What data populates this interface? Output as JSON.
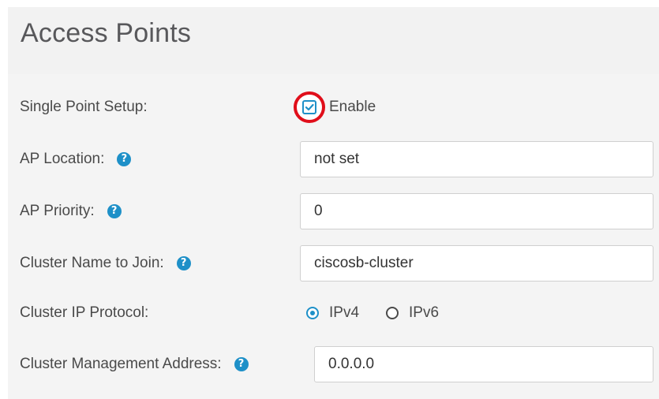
{
  "page": {
    "title": "Access Points"
  },
  "form": {
    "single_point_setup": {
      "label": "Single Point Setup:",
      "checkbox_label": "Enable",
      "checked": true
    },
    "ap_location": {
      "label": "AP Location:",
      "value": "not set",
      "help_icon": "question-circle-icon"
    },
    "ap_priority": {
      "label": "AP Priority:",
      "value": "0",
      "help_icon": "question-circle-icon"
    },
    "cluster_name": {
      "label": "Cluster Name to Join:",
      "value": "ciscosb-cluster",
      "help_icon": "question-circle-icon"
    },
    "cluster_ip_protocol": {
      "label": "Cluster IP Protocol:",
      "options": [
        "IPv4",
        "IPv6"
      ],
      "selected": "IPv4"
    },
    "cluster_mgmt_address": {
      "label": "Cluster Management Address:",
      "value": "0.0.0.0",
      "help_icon": "question-circle-icon"
    }
  },
  "colors": {
    "accent": "#1e90c8",
    "highlight_ring": "#e00e1a",
    "header_bg": "#f2f2f2",
    "form_bg": "#f4f4f4"
  }
}
